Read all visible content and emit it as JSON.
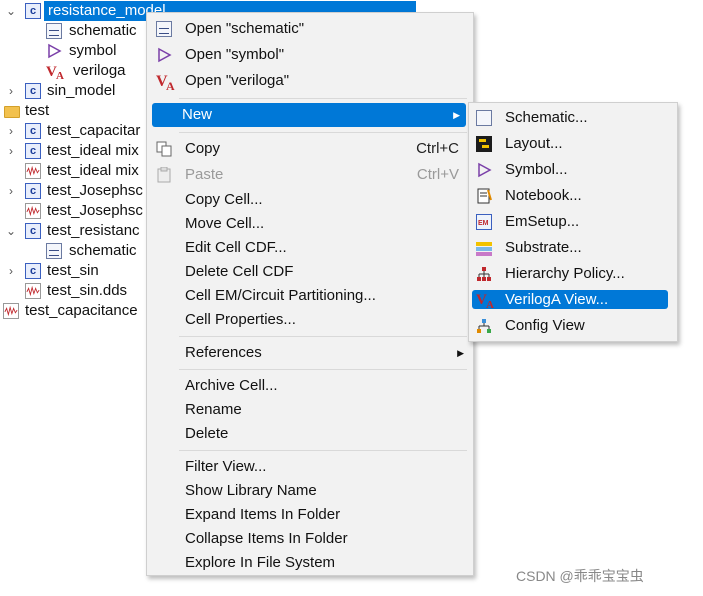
{
  "tree": {
    "resistance_model": "resistance_model",
    "schematic": "schematic",
    "symbol": "symbol",
    "veriloga": "veriloga",
    "sin_model": "sin_model",
    "test": "test",
    "test_capacitance_trunc": "test_capacitar",
    "test_ideal_mix_1": "test_ideal mix",
    "test_ideal_mix_2": "test_ideal mix",
    "test_josephson_1": "test_Josephsc",
    "test_josephson_2": "test_Josephsc",
    "test_resistance": "test_resistanc",
    "schematic2": "schematic",
    "test_sin": "test_sin",
    "test_sin_dds": "test_sin.dds",
    "test_capacitance": "test_capacitance"
  },
  "menu": {
    "open_schematic": "Open \"schematic\"",
    "open_symbol": "Open \"symbol\"",
    "open_veriloga": "Open \"veriloga\"",
    "new": "New",
    "copy": "Copy",
    "copy_accel": "Ctrl+C",
    "paste": "Paste",
    "paste_accel": "Ctrl+V",
    "copy_cell": "Copy Cell...",
    "move_cell": "Move Cell...",
    "edit_cell_cdf": "Edit Cell CDF...",
    "delete_cell_cdf": "Delete Cell CDF",
    "cell_em": "Cell EM/Circuit Partitioning...",
    "cell_properties": "Cell Properties...",
    "references": "References",
    "archive_cell": "Archive Cell...",
    "rename": "Rename",
    "delete": "Delete",
    "filter_view": "Filter View...",
    "show_library_name": "Show Library Name",
    "expand_items": "Expand Items In Folder",
    "collapse_items": "Collapse Items In Folder",
    "explore": "Explore In File System"
  },
  "submenu": {
    "schematic": "Schematic...",
    "layout": "Layout...",
    "symbol": "Symbol...",
    "notebook": "Notebook...",
    "emsetup": "EmSetup...",
    "substrate": "Substrate...",
    "hierarchy_policy": "Hierarchy Policy...",
    "veriloga_view": "VerilogA View...",
    "config_view": "Config View"
  },
  "watermark": "CSDN @乖乖宝宝虫"
}
